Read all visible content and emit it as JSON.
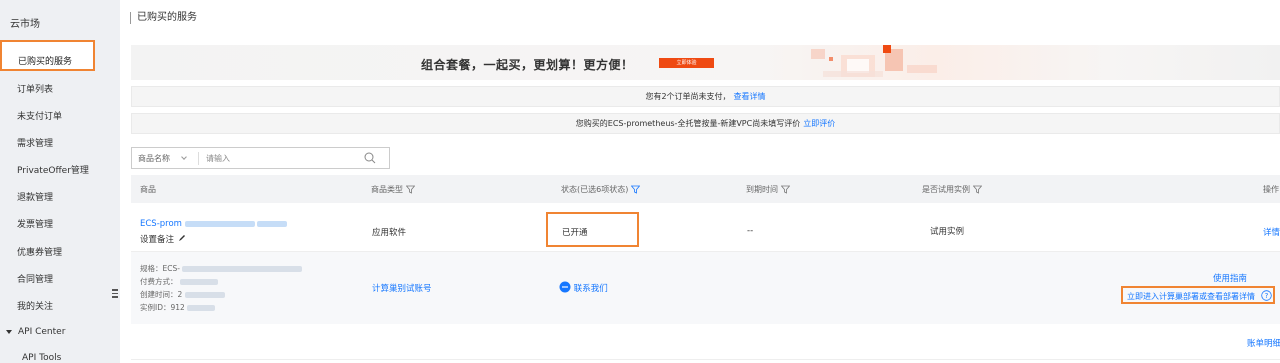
{
  "sidebar": {
    "title": "云市场",
    "items": [
      {
        "label": "已购买的服务"
      },
      {
        "label": "订单列表"
      },
      {
        "label": "未支付订单"
      },
      {
        "label": "需求管理"
      },
      {
        "label": "PrivateOffer管理"
      },
      {
        "label": "退款管理"
      },
      {
        "label": "发票管理"
      },
      {
        "label": "优惠券管理"
      },
      {
        "label": "合同管理"
      },
      {
        "label": "我的关注"
      }
    ],
    "group": {
      "label": "API Center",
      "items": [
        {
          "label": "API Tools"
        }
      ]
    }
  },
  "header": {
    "title": "已购买的服务"
  },
  "banner": {
    "text": "组合套餐，一起买，更划算！更方便！",
    "button": "立即体验"
  },
  "notices": {
    "unpaid": {
      "text": "您有2个订单尚未支付，",
      "link": "查看详情"
    },
    "review": {
      "text": "您购买的ECS-prometheus-全托管按量-新建VPC尚未填写评价",
      "link": "立即评价"
    }
  },
  "filter": {
    "select": "商品名称",
    "placeholder": "请输入"
  },
  "table": {
    "headers": [
      "商品",
      "商品类型",
      "状态(已选6项状态)",
      "到期时间",
      "是否试用实例",
      "操作"
    ],
    "row": {
      "product": "ECS-prom",
      "remark": "设置备注",
      "type": "应用软件",
      "status": "已开通",
      "expire": "--",
      "trial": "试用实例",
      "action": "详情"
    },
    "detail": {
      "spec_label": "规格：ECS-",
      "pay_label": "付费方式：",
      "created_label": "创建时间：2",
      "instance_label": "实例ID：912",
      "billing_link": "计算巢别试账号",
      "contact": "联系我们",
      "guide_link": "使用指南",
      "deploy_link": "立即进入计算巢部署或查看部署详情"
    },
    "footer_link": "账单明细"
  },
  "colors": {
    "accent": "#1677ff",
    "highlight": "#f08432",
    "banner_button": "#ef4a12"
  }
}
